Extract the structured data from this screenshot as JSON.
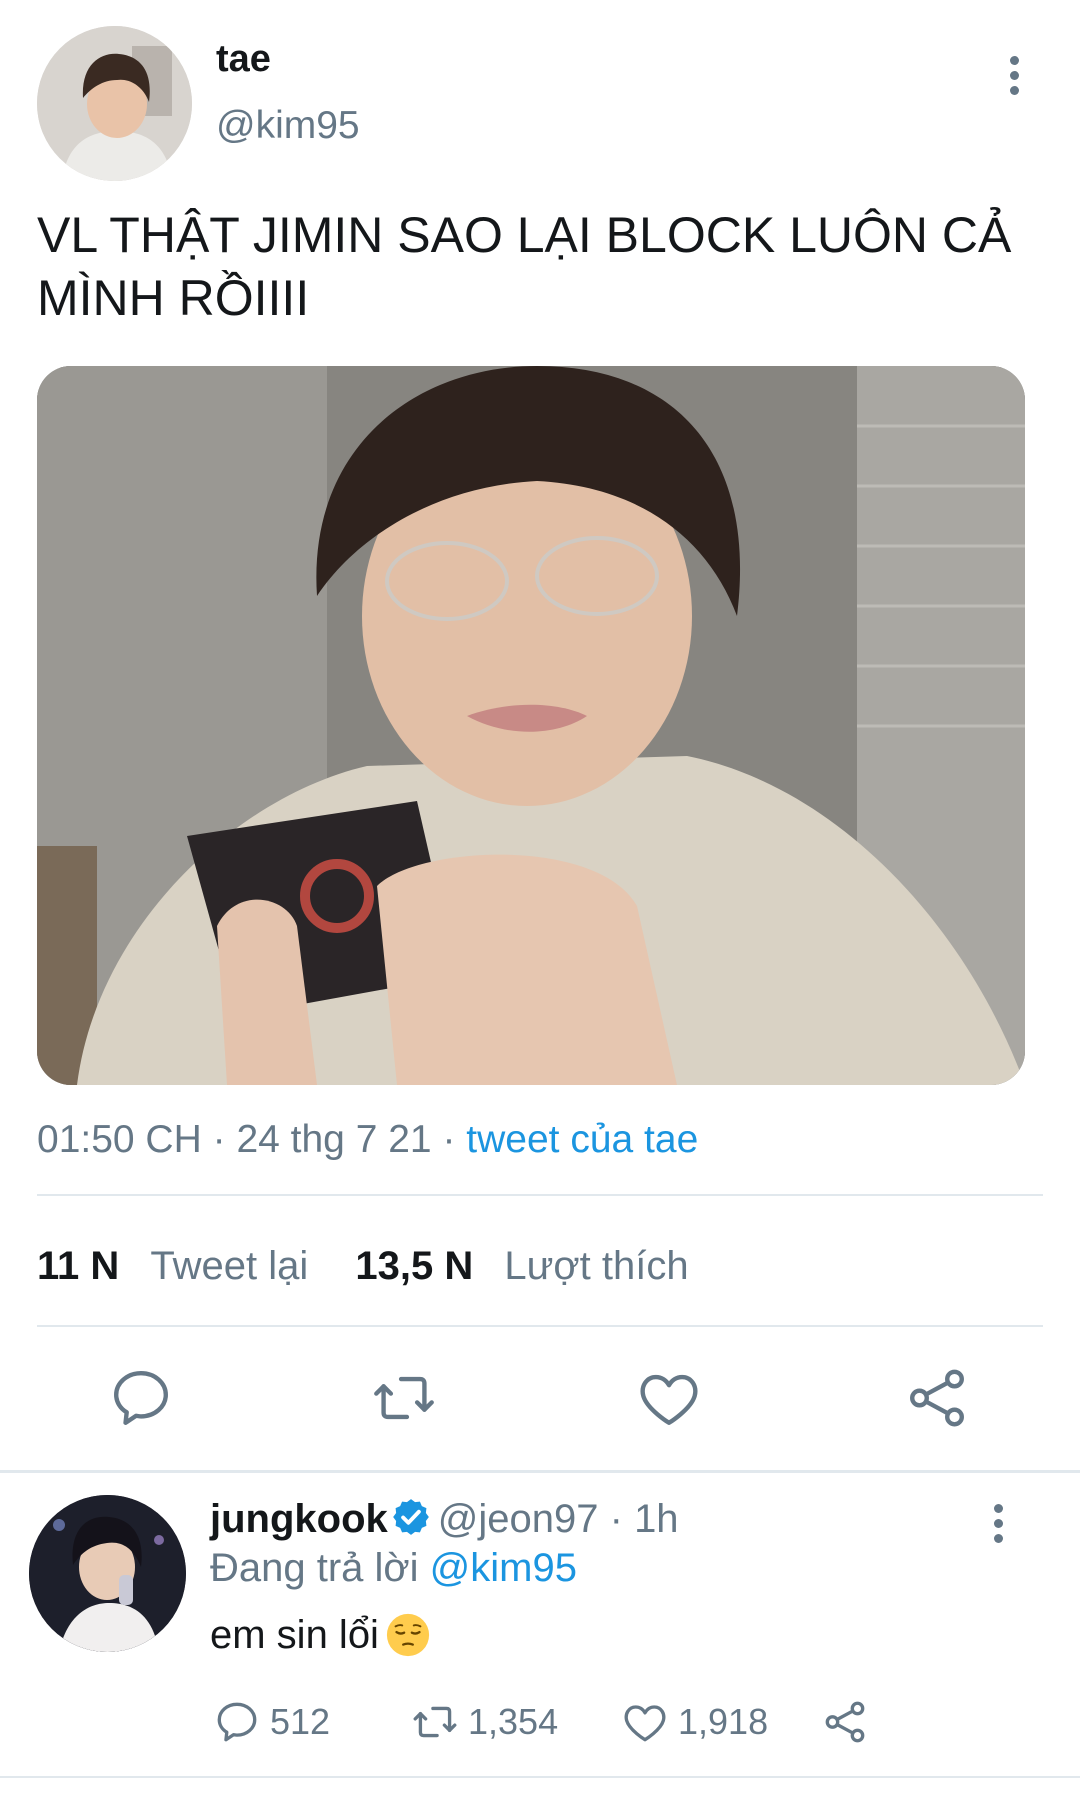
{
  "tweet": {
    "author_name": "tae",
    "author_handle": "@kim95",
    "text": "VL THẬT JIMIN SAO LẠI BLOCK LUÔN CẢ MÌNH RỒIIII",
    "time": "01:50 CH",
    "date": "24 thg 7 21",
    "via": "tweet của tae",
    "retweet_count": "11 N",
    "retweet_label": "Tweet lại",
    "like_count": "13,5 N",
    "like_label": "Lượt thích",
    "media_description": "photo"
  },
  "reply": {
    "author_name": "jungkook",
    "author_handle": "@jeon97",
    "age": "1h",
    "replying_label": "Đang trả lời",
    "replying_to": "@kim95",
    "text": "em sin lổi",
    "emoji": "pensive-face",
    "reply_count": "512",
    "retweet_count": "1,354",
    "like_count": "1,918"
  },
  "colors": {
    "link": "#1b95e0",
    "secondary_text": "#657786",
    "icon": "#657786",
    "divider": "#e1e8ed"
  },
  "icons": [
    "more-vertical-icon",
    "reply-icon",
    "retweet-icon",
    "like-icon",
    "share-icon",
    "verified-badge-icon"
  ]
}
